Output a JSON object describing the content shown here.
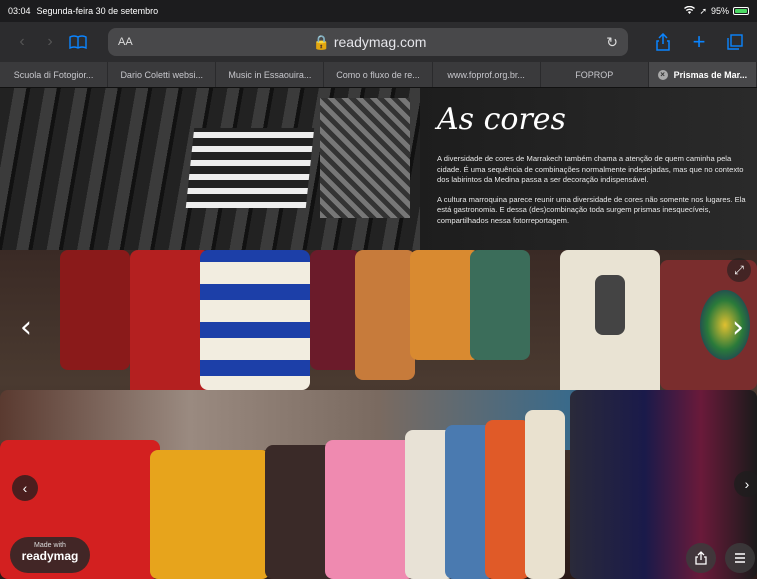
{
  "status_bar": {
    "time": "03:04",
    "date": "Segunda-feira 30 de setembro",
    "battery": "95%"
  },
  "toolbar": {
    "text_size_label": "AA",
    "address": "readymag.com"
  },
  "tabs": [
    {
      "label": "Scuola di Fotogior...",
      "active": false
    },
    {
      "label": "Dario Coletti websi...",
      "active": false
    },
    {
      "label": "Music in Essaouira...",
      "active": false
    },
    {
      "label": "Como o fluxo de re...",
      "active": false
    },
    {
      "label": "www.foprof.org.br...",
      "active": false
    },
    {
      "label": "FOPROP",
      "active": false
    },
    {
      "label": "Prismas de Mar...",
      "active": true
    }
  ],
  "banner": {
    "title": "As cores",
    "paragraph1": "A diversidade de cores de Marrakech também chama a atenção de quem caminha pela cidade. É uma sequência de combinações normalmente indesejadas, mas que no contexto dos labirintos da Medina passa a ser decoração indispensável.",
    "paragraph2": "A cultura marroquina parece reunir uma diversidade de cores não somente nos lugares. Ela está gastronomia. E dessa (des)combinação toda surgem prismas inesquecíveis, compartilhados nessa fotorreportagem."
  },
  "badge": {
    "small": "Made with",
    "brand": "readymag"
  },
  "icons": {
    "wifi": "wifi-icon",
    "location": "location-arrow-icon",
    "back": "chevron-left-icon",
    "forward": "chevron-right-icon",
    "bookmarks": "book-icon",
    "lock": "lock-icon",
    "reload": "reload-icon",
    "share": "share-icon",
    "new_tab": "plus-icon",
    "tabs": "tabs-icon",
    "expand": "expand-icon",
    "menu": "menu-icon"
  }
}
